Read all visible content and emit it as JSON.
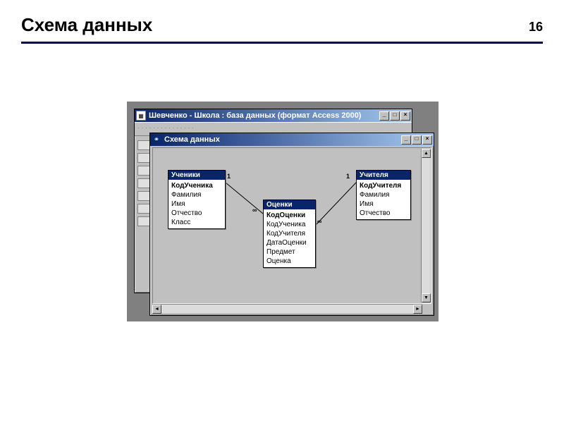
{
  "slide": {
    "title": "Схема данных",
    "number": "16"
  },
  "backWindow": {
    "title": "Шевченко - Школа : база данных (формат Access 2000)"
  },
  "frontWindow": {
    "title": "Схема данных"
  },
  "tables": {
    "t1": {
      "name": "Ученики",
      "fields": [
        "КодУченика",
        "Фамилия",
        "Имя",
        "Отчество",
        "Класс"
      ],
      "pk": 0
    },
    "t2": {
      "name": "Оценки",
      "fields": [
        "КодОценки",
        "КодУченика",
        "КодУчителя",
        "ДатаОценки",
        "Предмет",
        "Оценка"
      ],
      "pk": 0
    },
    "t3": {
      "name": "Учителя",
      "fields": [
        "КодУчителя",
        "Фамилия",
        "Имя",
        "Отчество"
      ],
      "pk": 0
    }
  },
  "relations": {
    "r1_left": "1",
    "r1_right": "∞",
    "r2_left": "∞",
    "r2_right": "1"
  }
}
